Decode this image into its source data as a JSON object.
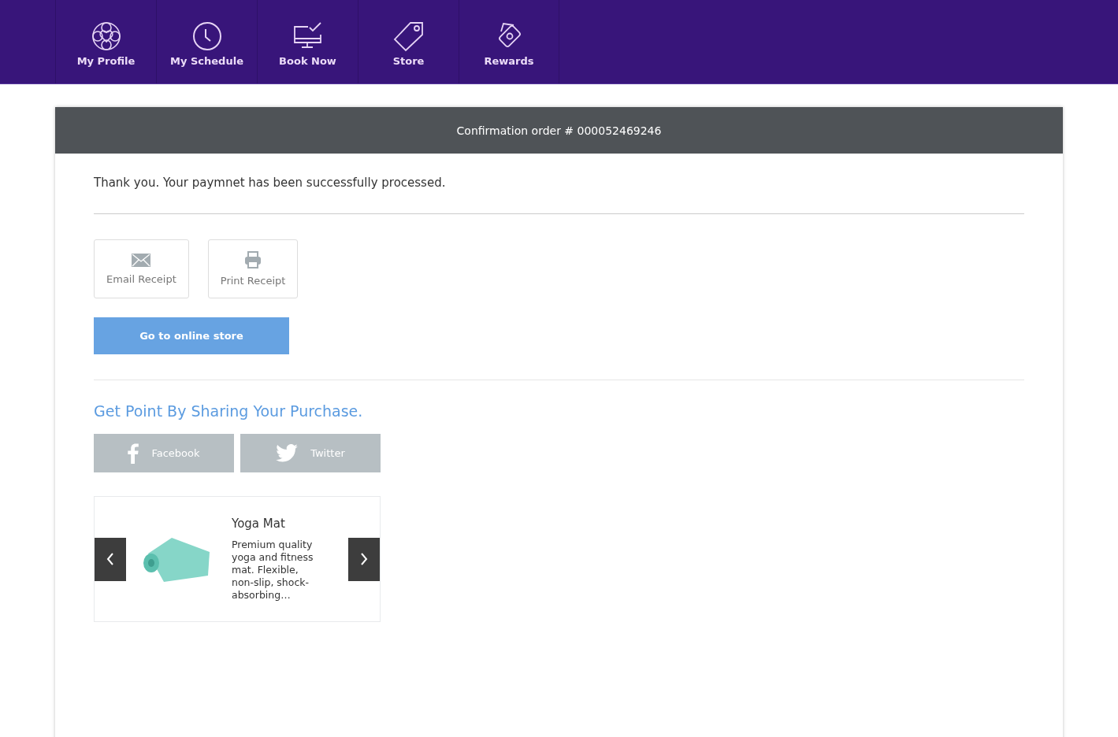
{
  "nav": [
    {
      "label": "My Profile"
    },
    {
      "label": "My Schedule"
    },
    {
      "label": "Book Now"
    },
    {
      "label": "Store"
    },
    {
      "label": "Rewards"
    }
  ],
  "confirmation": {
    "title": "Confirmation order # 000052469246",
    "message": "Thank you. Your paymnet has been successfully processed.",
    "receipt_buttons": [
      {
        "label": "Email Receipt"
      },
      {
        "label": "Print Receipt"
      }
    ],
    "store_button": "Go to online store",
    "share_heading": "Get Point By Sharing Your Purchase.",
    "share_buttons": [
      {
        "label": "Facebook"
      },
      {
        "label": "Twitter"
      }
    ],
    "product": {
      "name": "Yoga Mat",
      "description": "Premium quality yoga and fitness mat. Flexible, non-slip, shock-absorbing…"
    }
  }
}
